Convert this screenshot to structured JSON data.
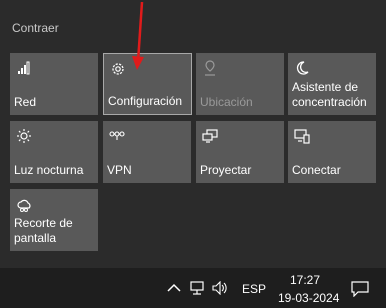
{
  "panel": {
    "collapse_label": "Contraer"
  },
  "tiles": [
    {
      "label": "Red",
      "icon": "network-icon",
      "enabled": true
    },
    {
      "label": "Configuración",
      "icon": "settings-gear-icon",
      "enabled": true,
      "selected": true
    },
    {
      "label": "Ubicación",
      "icon": "location-icon",
      "enabled": false
    },
    {
      "label": "Asistente de concentración",
      "icon": "focus-assist-moon-icon",
      "enabled": true
    },
    {
      "label": "Luz nocturna",
      "icon": "night-light-sun-icon",
      "enabled": true
    },
    {
      "label": "VPN",
      "icon": "vpn-icon",
      "enabled": true
    },
    {
      "label": "Proyectar",
      "icon": "project-icon",
      "enabled": true
    },
    {
      "label": "Conectar",
      "icon": "connect-icon",
      "enabled": true
    },
    {
      "label": "Recorte de pantalla",
      "icon": "screen-snip-icon",
      "enabled": true
    }
  ],
  "taskbar": {
    "language": "ESP",
    "time": "17:27",
    "date": "19-03-2024"
  },
  "colors": {
    "background": "#2b2b2b",
    "tile": "#595959",
    "tile_disabled_text": "#9a9a9a",
    "taskbar": "#1e1e1e",
    "annotation_arrow": "#e01b1b"
  }
}
